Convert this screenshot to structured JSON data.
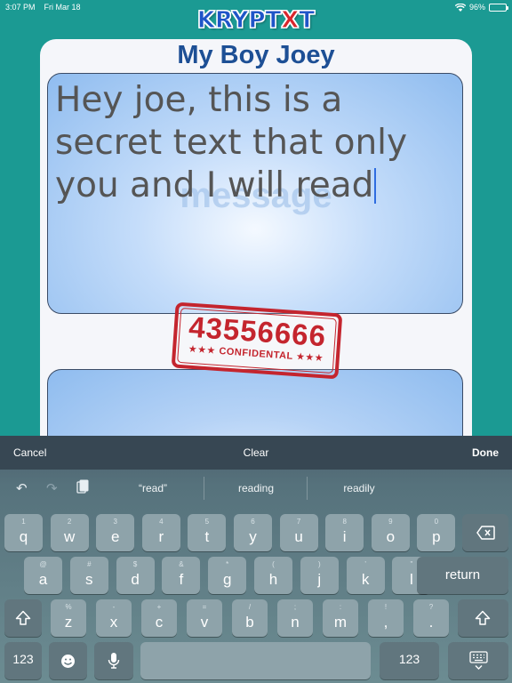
{
  "status_bar": {
    "time": "3:07 PM",
    "date": "Fri Mar 18",
    "battery": "96%",
    "battery_level": 0.96,
    "wifi_icon": "wifi-icon"
  },
  "app": {
    "logo_prefix": "KRYPT",
    "logo_x": "X",
    "logo_suffix": "T"
  },
  "conversation": {
    "contact_name": "My Boy Joey",
    "message_placeholder": "message",
    "message_text": "Hey joe, this is a secret text that only you and I will read",
    "stamp_code": "43556666",
    "stamp_label": "★★★ CONFIDENTAL ★★★"
  },
  "keyboard": {
    "accessory": {
      "cancel": "Cancel",
      "clear": "Clear",
      "done": "Done"
    },
    "suggestions": [
      "“read”",
      "reading",
      "readily"
    ],
    "row1": [
      {
        "main": "q",
        "sub": "1"
      },
      {
        "main": "w",
        "sub": "2"
      },
      {
        "main": "e",
        "sub": "3"
      },
      {
        "main": "r",
        "sub": "4"
      },
      {
        "main": "t",
        "sub": "5"
      },
      {
        "main": "y",
        "sub": "6"
      },
      {
        "main": "u",
        "sub": "7"
      },
      {
        "main": "i",
        "sub": "8"
      },
      {
        "main": "o",
        "sub": "9"
      },
      {
        "main": "p",
        "sub": "0"
      }
    ],
    "row2": [
      {
        "main": "a",
        "sub": "@"
      },
      {
        "main": "s",
        "sub": "#"
      },
      {
        "main": "d",
        "sub": "$"
      },
      {
        "main": "f",
        "sub": "&"
      },
      {
        "main": "g",
        "sub": "*"
      },
      {
        "main": "h",
        "sub": "("
      },
      {
        "main": "j",
        "sub": ")"
      },
      {
        "main": "k",
        "sub": "’"
      },
      {
        "main": "l",
        "sub": "\""
      }
    ],
    "row3": [
      {
        "main": "z",
        "sub": "%"
      },
      {
        "main": "x",
        "sub": "-"
      },
      {
        "main": "c",
        "sub": "+"
      },
      {
        "main": "v",
        "sub": "="
      },
      {
        "main": "b",
        "sub": "/"
      },
      {
        "main": "n",
        "sub": ";"
      },
      {
        "main": "m",
        "sub": ":"
      },
      {
        "main": ",",
        "sub": "!"
      },
      {
        "main": ".",
        "sub": "?"
      }
    ],
    "return_label": "return",
    "numbers_label": "123"
  }
}
